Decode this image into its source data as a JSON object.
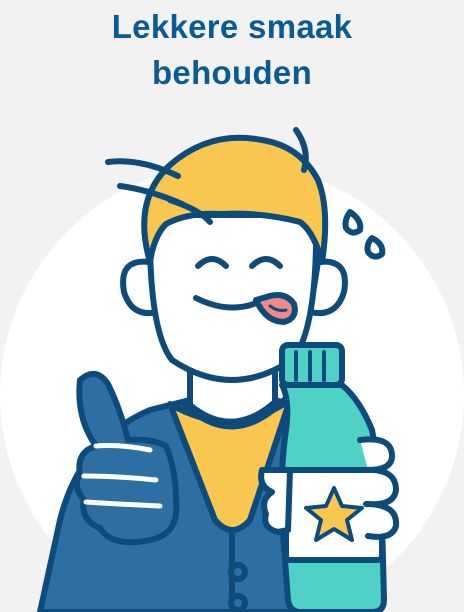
{
  "headline": {
    "line1": "Lekkere smaak",
    "line2": "behouden"
  },
  "colors": {
    "background": "#f2f2f2",
    "circle": "#ffffff",
    "title": "#0a5a93",
    "outline": "#0d4b7c",
    "hair": "#f9c74f",
    "shirt": "#f9c74f",
    "cardigan": "#2e6fa3",
    "bottle": "#4fd1c5",
    "tongue": "#f08a8a",
    "star": "#f9c74f"
  },
  "illustration": {
    "subject": "smiling-man-thumbs-up-holding-water-bottle"
  }
}
